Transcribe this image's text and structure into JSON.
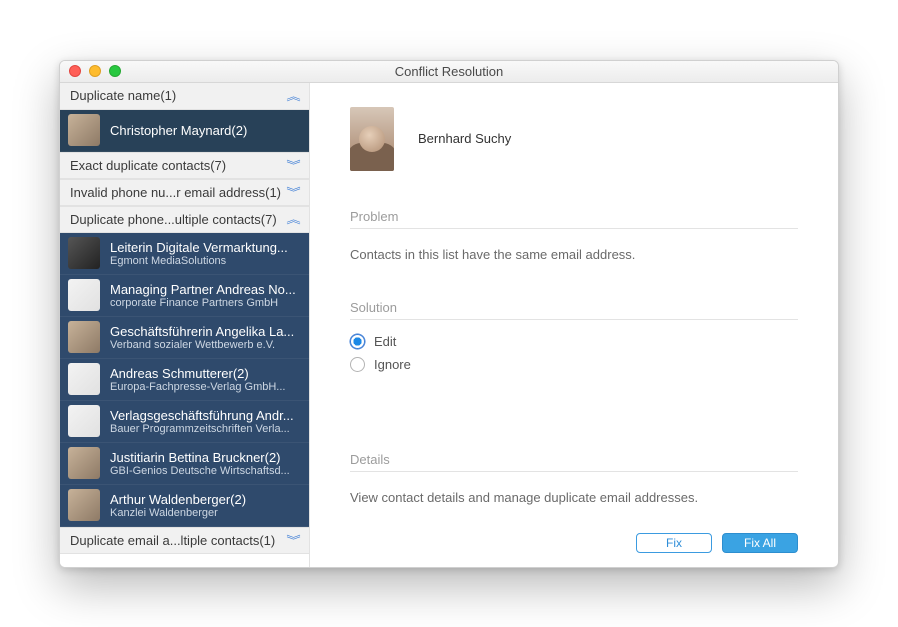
{
  "window": {
    "title": "Conflict Resolution"
  },
  "sidebar": {
    "sections": [
      {
        "label": "Duplicate name(1)",
        "expanded": true
      },
      {
        "label": "Exact duplicate contacts(7)",
        "expanded": false
      },
      {
        "label": "Invalid phone nu...r email address(1)",
        "expanded": false
      },
      {
        "label": "Duplicate phone...ultiple contacts(7)",
        "expanded": true
      },
      {
        "label": "Duplicate email a...ltiple contacts(1)",
        "expanded": false
      }
    ],
    "section0_items": [
      {
        "name": "Christopher Maynard(2)",
        "sub": ""
      }
    ],
    "section3_items": [
      {
        "name": "Leiterin Digitale Vermarktung...",
        "sub": "Egmont MediaSolutions"
      },
      {
        "name": "Managing Partner Andreas No...",
        "sub": "corporate Finance Partners GmbH"
      },
      {
        "name": "Geschäftsführerin Angelika La...",
        "sub": "Verband sozialer Wettbewerb e.V."
      },
      {
        "name": "Andreas Schmutterer(2)",
        "sub": "Europa-Fachpresse-Verlag GmbH..."
      },
      {
        "name": "Verlagsgeschäftsführung Andr...",
        "sub": "Bauer Programmzeitschriften Verla..."
      },
      {
        "name": "Justitiarin Bettina Bruckner(2)",
        "sub": "GBI-Genios Deutsche Wirtschaftsd..."
      },
      {
        "name": "Arthur Waldenberger(2)",
        "sub": "Kanzlei Waldenberger"
      }
    ]
  },
  "detail": {
    "contact_name": "Bernhard Suchy",
    "problem_label": "Problem",
    "problem_text": "Contacts in this list have the same email address.",
    "solution_label": "Solution",
    "options": {
      "edit": "Edit",
      "ignore": "Ignore",
      "selected": "edit"
    },
    "details_label": "Details",
    "details_text": "View contact details and manage duplicate email addresses.",
    "buttons": {
      "fix": "Fix",
      "fix_all": "Fix All"
    }
  }
}
